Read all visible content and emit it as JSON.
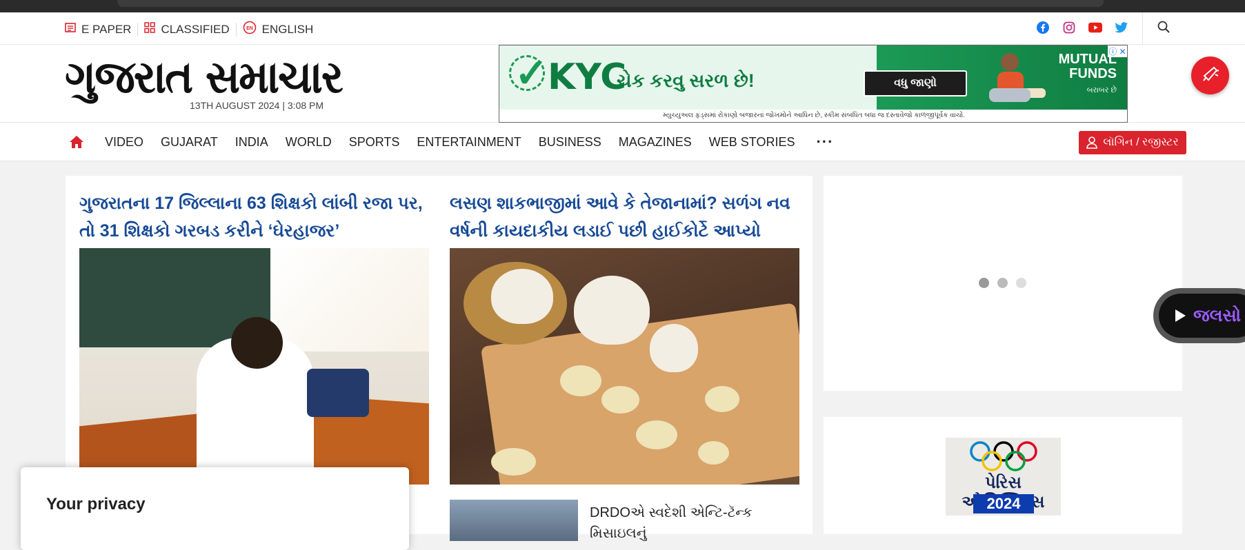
{
  "topbar": {
    "links": [
      {
        "label": "E PAPER",
        "icon": "newspaper-icon"
      },
      {
        "label": "CLASSIFIED",
        "icon": "grid-icon"
      },
      {
        "label": "ENGLISH",
        "icon": "language-icon"
      }
    ],
    "language_badge": "EN",
    "social": [
      "facebook-icon",
      "instagram-icon",
      "youtube-icon",
      "twitter-icon"
    ]
  },
  "masthead": {
    "logo_text": "ગુજરાત સમાચાર",
    "dateline": "13TH AUGUST 2024 | 3:08 PM"
  },
  "ad": {
    "kyc": "KYC",
    "headline": "ચેક કરવુ સરળ છે!",
    "button": "વધુ જાણો",
    "brand_line1": "MUTUAL",
    "brand_line2": "FUNDS",
    "brand_tag": "બરાબર છે",
    "disclaimer": "મ્યુચ્યુઅલ ફંડ્સમાં રોકાણો બજારનાં જોખમોને આધિન છે, સ્કીમ સંબંધિત બધા જ દસ્તાવેજો કાળજીપૂર્વક વાંચો.",
    "adchoice": "ⓘ",
    "close": "✕"
  },
  "nav": {
    "items": [
      "VIDEO",
      "GUJARAT",
      "INDIA",
      "WORLD",
      "SPORTS",
      "ENTERTAINMENT",
      "BUSINESS",
      "MAGAZINES",
      "WEB STORIES"
    ],
    "more": "···",
    "login": "લૉગિન / રજીસ્ટર"
  },
  "stories": [
    {
      "title": "ગુજરાતના 17 જિલ્લાના 63 શિક્ષકો લાંબી રજા પર, તો 31 શિક્ષકો ગરબડ કરીને ‘ઘેરહાજર’"
    },
    {
      "title": "લસણ શાકભાજીમાં આવે કે તેજાનામાં? સળંગ નવ વર્ષની કાયદાકીય લડાઈ પછી હાઈકોર્ટે આપ્યો ચુકાદો"
    }
  ],
  "small_story": {
    "title": "DRDOએ સ્વદેશી એન્ટિ-ટૅન્ક મિસાઇલનું"
  },
  "olympics": {
    "title": "પેરિસ ઓલિમ્પિક્સ",
    "year": "2024"
  },
  "jalso": {
    "label": "જલસો"
  },
  "privacy": {
    "title": "Your privacy"
  },
  "colors": {
    "accent": "#d9232d",
    "headline": "#174a96"
  }
}
